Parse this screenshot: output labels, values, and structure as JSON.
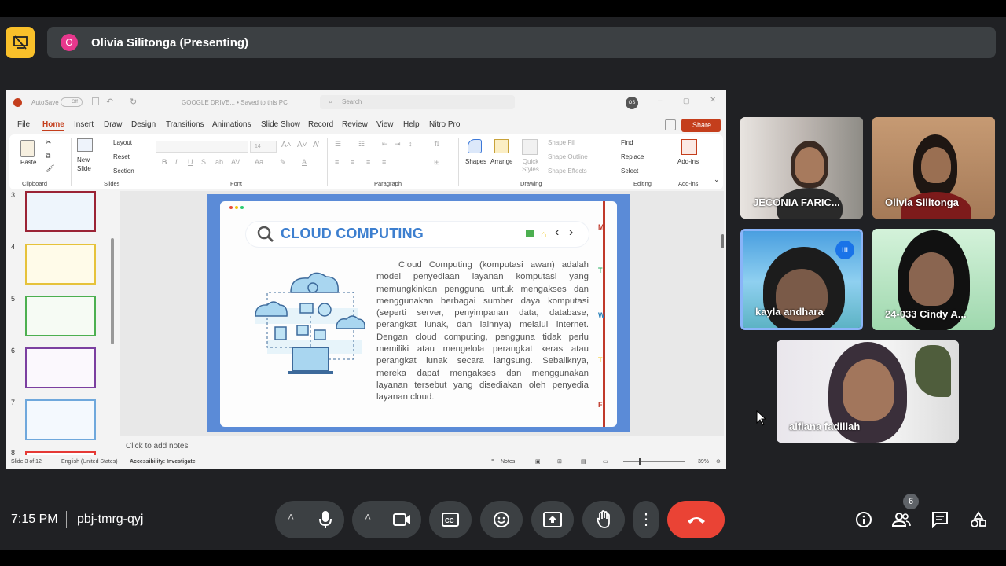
{
  "presenter": {
    "avatar_letter": "O",
    "label": "Olivia Silitonga (Presenting)"
  },
  "ppt": {
    "autosave": "AutoSave",
    "autosave_state": "Off",
    "doc_title": "GOOGLE DRIVE... • Saved to this PC",
    "search_placeholder": "Search",
    "user_initials": "OS",
    "menu": [
      "File",
      "Home",
      "Insert",
      "Draw",
      "Design",
      "Transitions",
      "Animations",
      "Slide Show",
      "Record",
      "Review",
      "View",
      "Help",
      "Nitro Pro"
    ],
    "share": "Share",
    "ribbon": {
      "paste": "Paste",
      "clipboard": "Clipboard",
      "new_slide": "New Slide",
      "layout": "Layout",
      "reset": "Reset",
      "section": "Section",
      "slides": "Slides",
      "font_size": "14",
      "font": "Font",
      "paragraph": "Paragraph",
      "shapes": "Shapes",
      "arrange": "Arrange",
      "quick_styles": "Quick Styles",
      "shape_fill": "Shape Fill",
      "shape_outline": "Shape Outline",
      "shape_effects": "Shape Effects",
      "drawing": "Drawing",
      "find": "Find",
      "replace": "Replace",
      "select": "Select",
      "editing": "Editing",
      "addins": "Add-ins"
    },
    "thumb_numbers": [
      "3",
      "4",
      "5",
      "6",
      "7",
      "8"
    ],
    "slide": {
      "title": "CLOUD COMPUTING",
      "body": "Cloud Computing (komputasi awan) adalah model penyediaan layanan komputasi yang memungkinkan pengguna untuk mengakses dan menggunakan berbagai sumber daya komputasi (seperti server, penyimpanan data, database, perangkat lunak, dan lainnya) melalui internet. Dengan cloud computing, pengguna tidak perlu memiliki atau mengelola perangkat keras atau perangkat lunak secara langsung. Sebaliknya, mereka dapat mengakses dan menggunakan layanan tersebut yang disediakan oleh penyedia layanan cloud.",
      "side_letters": [
        "M",
        "T",
        "W",
        "T",
        "F"
      ]
    },
    "notes_placeholder": "Click to add notes",
    "status": {
      "slide": "Slide 3 of 12",
      "lang": "English (United States)",
      "access": "Accessibility: Investigate",
      "notes": "Notes",
      "zoom": "39%"
    }
  },
  "participants": [
    {
      "name": "JECONIA FARIC..."
    },
    {
      "name": "Olivia Silitonga"
    },
    {
      "name": "kayla andhara"
    },
    {
      "name": "24-033 Cindy A..."
    },
    {
      "name": "alfiana fadillah"
    }
  ],
  "bottom": {
    "time": "7:15 PM",
    "code": "pbj-tmrg-qyj",
    "people_count": "6"
  },
  "colors": {
    "accent_red": "#ea4335",
    "meet_bg": "#202124",
    "presenting_yellow": "#f9c02a"
  }
}
